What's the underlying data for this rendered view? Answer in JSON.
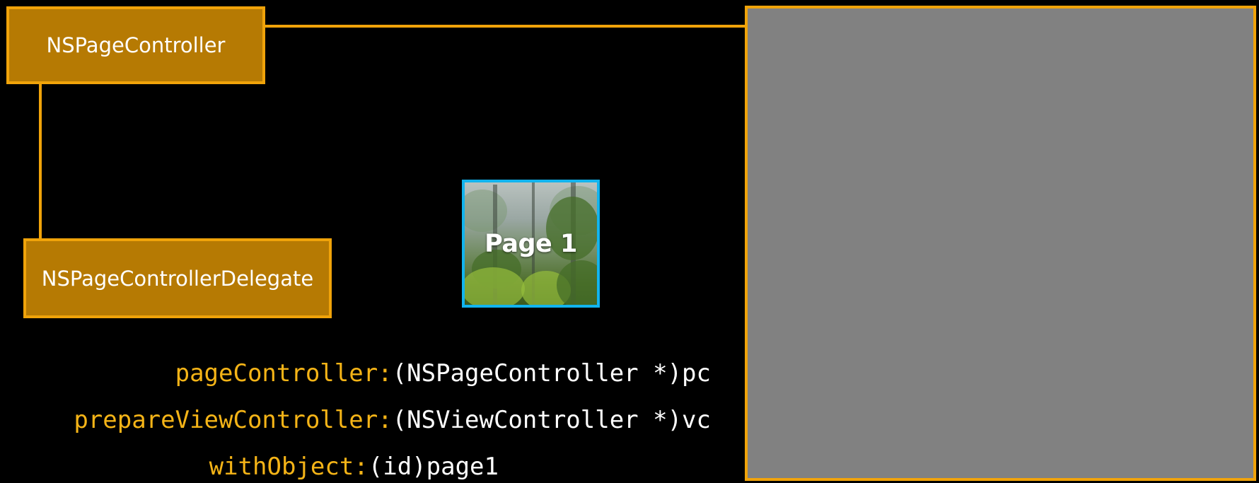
{
  "diagram": {
    "nodes": {
      "page_controller": {
        "label": "NSPageController"
      },
      "delegate": {
        "label": "NSPageControllerDelegate"
      },
      "page_thumbnail": {
        "label": "Page 1"
      }
    },
    "code": {
      "lines": [
        {
          "selector": "pageController:",
          "arg": "(NSPageController *)pc"
        },
        {
          "selector": "prepareViewController:",
          "arg": "(NSViewController *)vc"
        },
        {
          "selector": "withObject:",
          "arg": "(id)page1"
        }
      ]
    }
  },
  "colors": {
    "box_fill": "#b67a03",
    "box_border": "#f0a30a",
    "thumbnail_border": "#12b4ee",
    "selector_text": "#f5b417",
    "argument_text": "#ffffff",
    "panel_fill": "#818181",
    "background": "#000000"
  }
}
